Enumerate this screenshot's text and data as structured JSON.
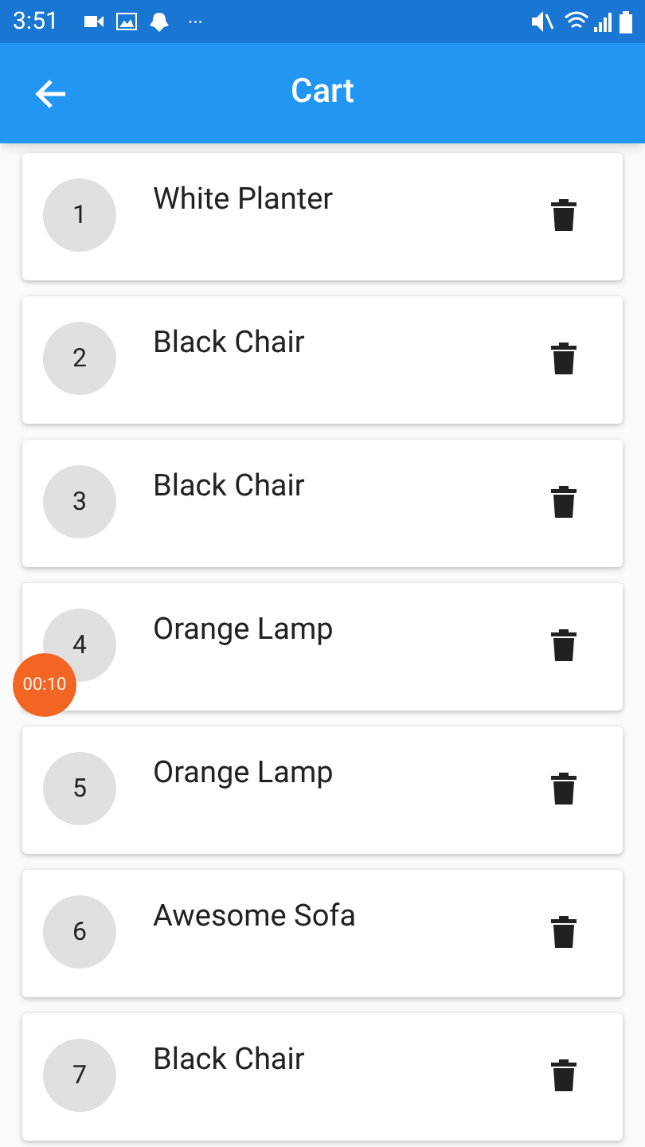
{
  "status_bar": {
    "time": "3:51",
    "more": "···"
  },
  "app_bar": {
    "title": "Cart"
  },
  "items": [
    {
      "number": "1",
      "name": "White Planter"
    },
    {
      "number": "2",
      "name": "Black Chair"
    },
    {
      "number": "3",
      "name": "Black Chair"
    },
    {
      "number": "4",
      "name": "Orange Lamp"
    },
    {
      "number": "5",
      "name": "Orange Lamp"
    },
    {
      "number": "6",
      "name": "Awesome Sofa"
    },
    {
      "number": "7",
      "name": "Black Chair"
    }
  ],
  "timer_badge": {
    "text": "00:10"
  }
}
